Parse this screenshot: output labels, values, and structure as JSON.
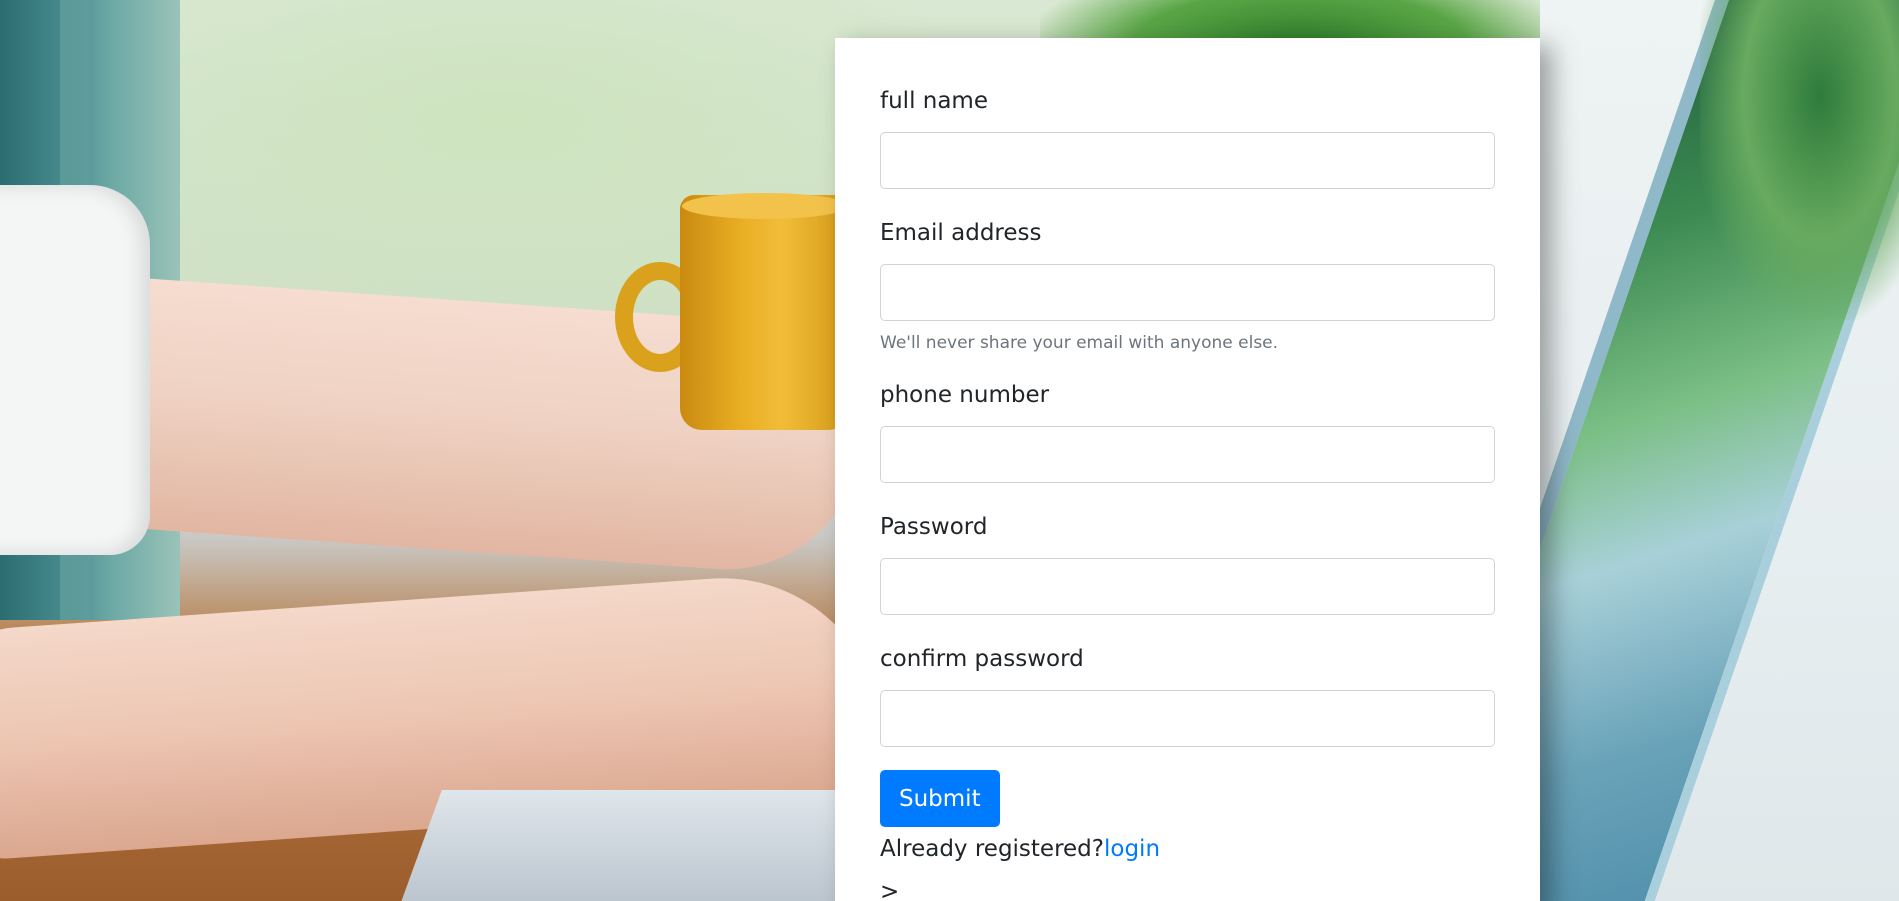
{
  "form": {
    "full_name": {
      "label": "full name",
      "value": "",
      "placeholder": ""
    },
    "email": {
      "label": "Email address",
      "value": "",
      "placeholder": "",
      "help": "We'll never share your email with anyone else."
    },
    "phone": {
      "label": "phone number",
      "value": "",
      "placeholder": ""
    },
    "password": {
      "label": "Password",
      "value": "",
      "placeholder": ""
    },
    "confirm_password": {
      "label": "confirm password",
      "value": "",
      "placeholder": ""
    },
    "submit_label": "Submit",
    "already_registered_text": "Already registered?",
    "login_link": "login",
    "stray_text": ">"
  },
  "colors": {
    "accent": "#007bff",
    "text": "#212529",
    "muted": "#6c757d",
    "input_border": "#ced4da",
    "card_bg": "#ffffff"
  }
}
